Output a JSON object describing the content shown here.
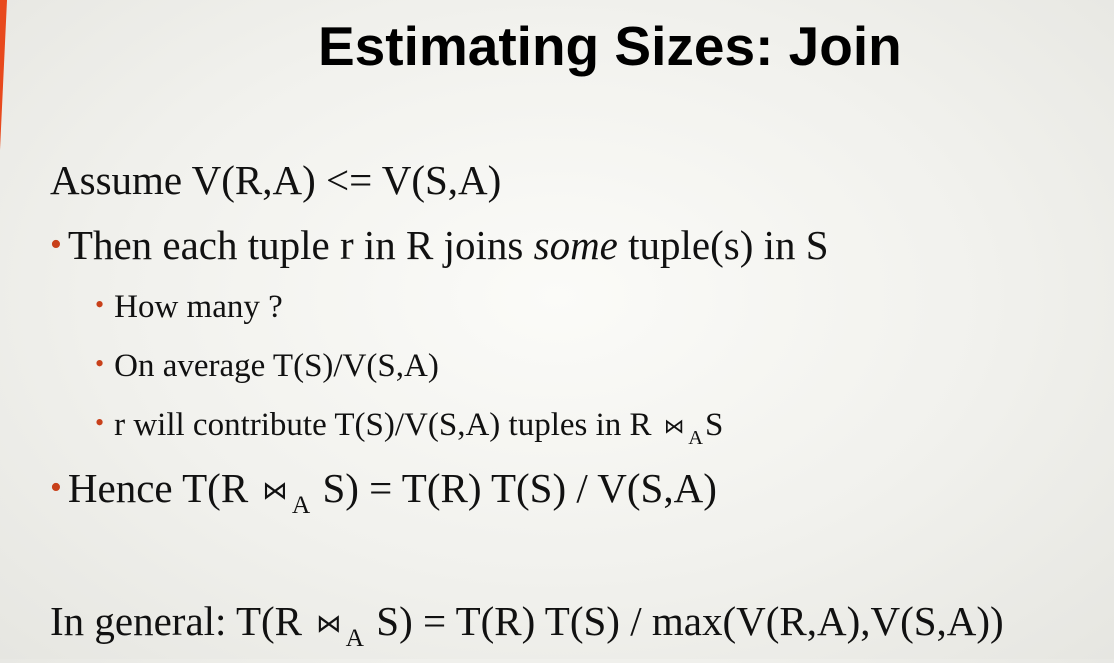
{
  "slide": {
    "title": "Estimating Sizes: Join",
    "intro": "Assume V(R,A) <= V(S,A)",
    "bullets": [
      {
        "before": "Then each tuple r in R joins ",
        "em": "some",
        "after": " tuple(s) in S"
      },
      {
        "text": "How many ?"
      },
      {
        "text": "On average T(S)/V(S,A)"
      },
      {
        "before": "r will contribute T(S)/V(S,A) tuples in R ",
        "join": "⋈",
        "sub": "A",
        "after": "S"
      },
      {
        "before": "Hence T(R ",
        "join": "⋈",
        "sub": "A",
        "after": " S) = T(R) T(S) / V(S,A)"
      }
    ],
    "general": {
      "before": "In general: T(R ",
      "join": "⋈",
      "sub": "A",
      "after": " S) = T(R) T(S) / max(V(R,A),V(S,A))"
    },
    "bullet_glyph": "•",
    "colors": {
      "bullet": "#c8401a",
      "accent": "#e8491d"
    }
  }
}
